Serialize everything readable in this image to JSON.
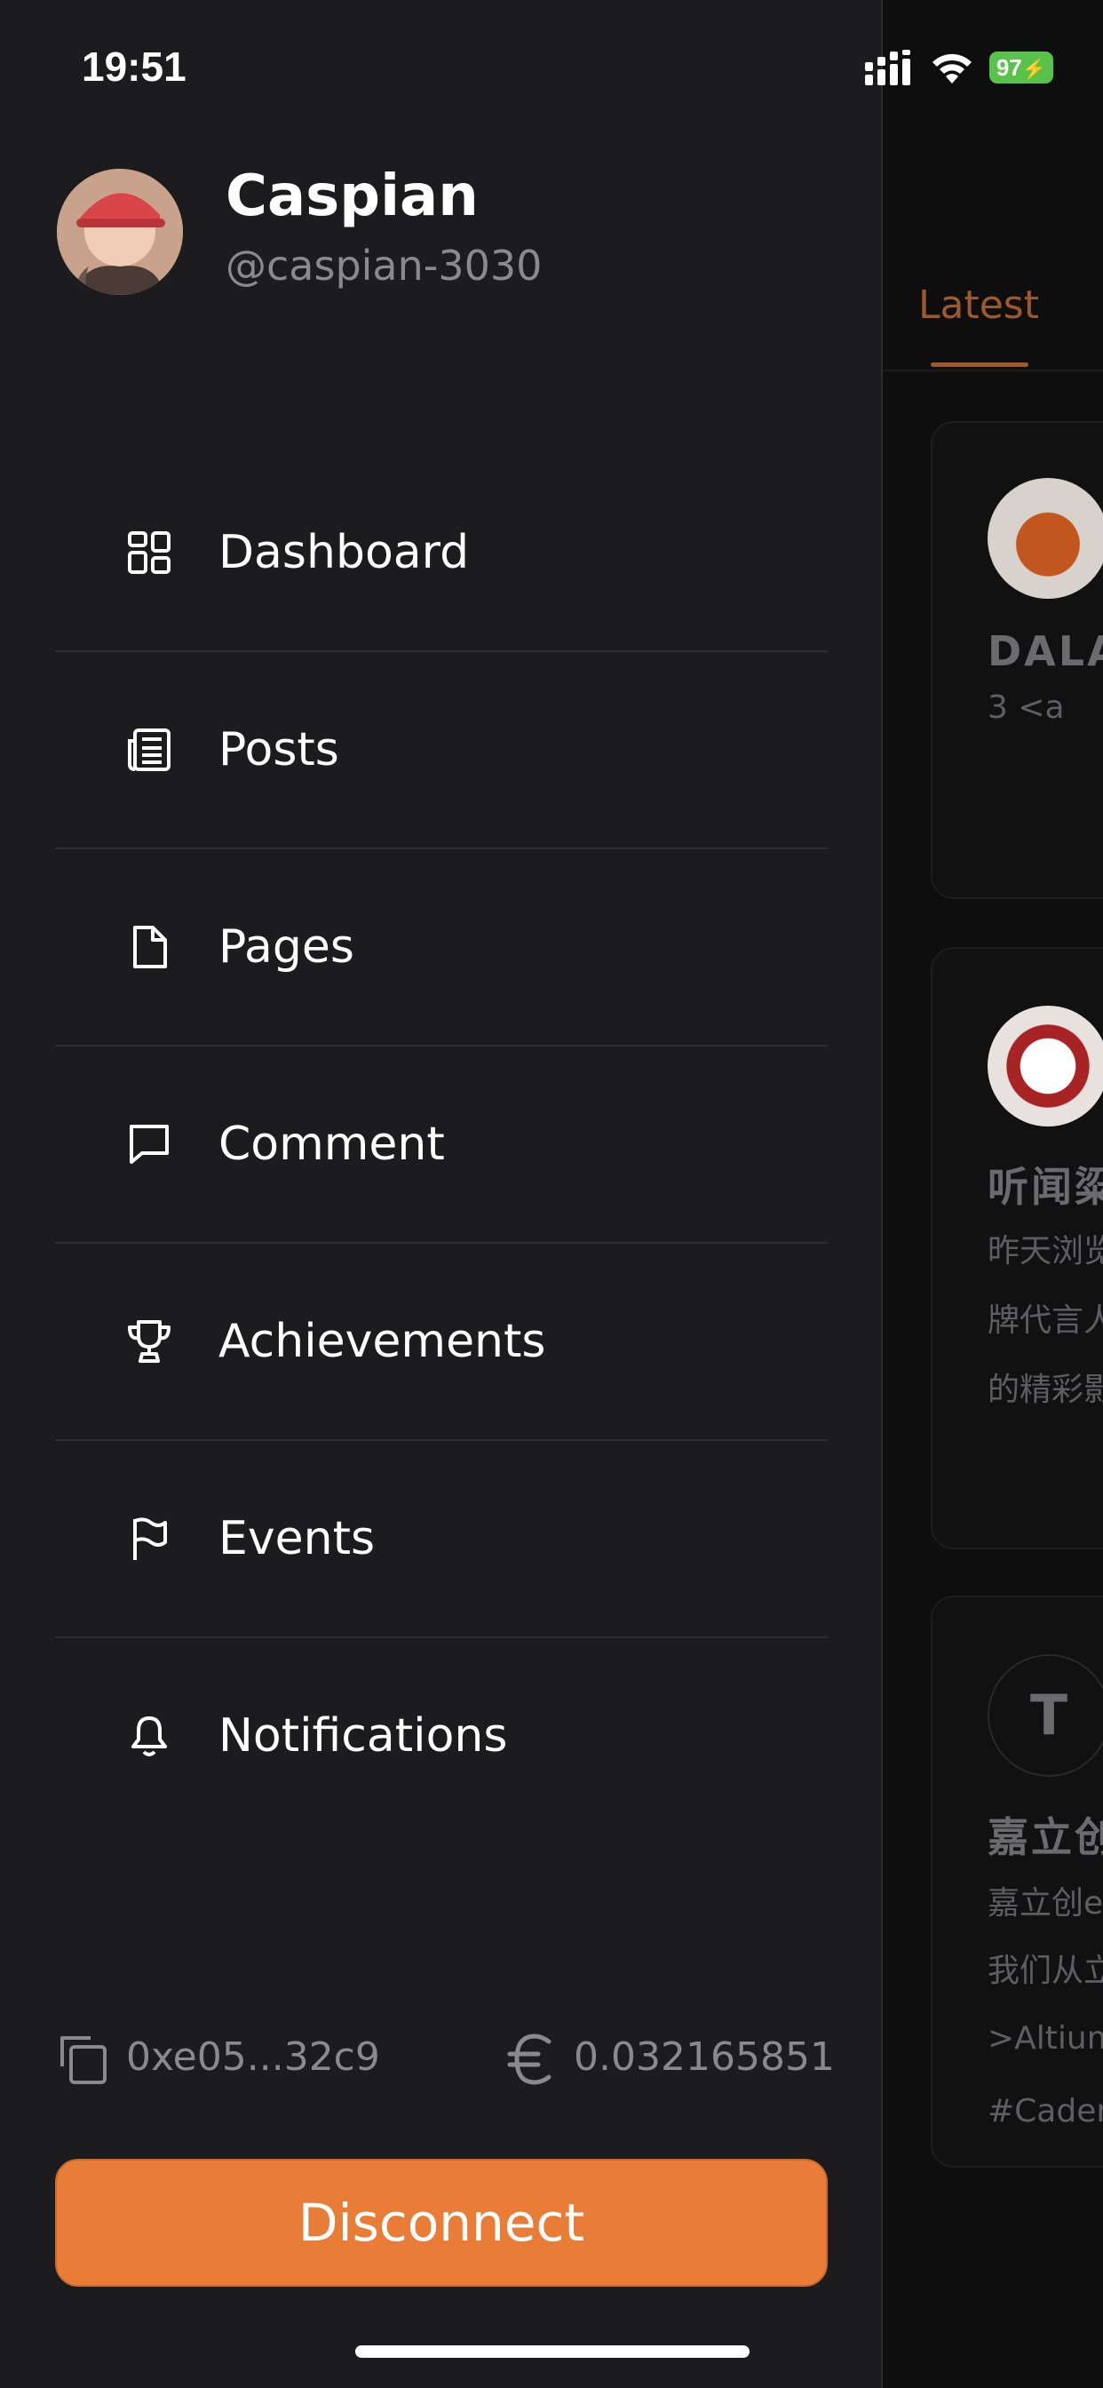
{
  "status_bar": {
    "time": "19:51",
    "battery": "97"
  },
  "profile": {
    "name": "Caspian",
    "handle": "@caspian-3030"
  },
  "menu": {
    "items": [
      {
        "label": "Dashboard",
        "icon": "dashboard-icon"
      },
      {
        "label": "Posts",
        "icon": "posts-icon"
      },
      {
        "label": "Pages",
        "icon": "page-icon"
      },
      {
        "label": "Comment",
        "icon": "comment-icon"
      },
      {
        "label": "Achievements",
        "icon": "trophy-icon"
      },
      {
        "label": "Events",
        "icon": "flag-icon"
      },
      {
        "label": "Notifications",
        "icon": "bell-icon"
      }
    ]
  },
  "wallet": {
    "address": "0xe05...32c9",
    "balance": "0.032165851"
  },
  "actions": {
    "disconnect_label": "Disconnect"
  },
  "feed": {
    "active_tab": "Latest",
    "cards": [
      {
        "title": "DALA",
        "line1": "3   <a"
      },
      {
        "title": "听闻粱",
        "line1": "昨天浏览",
        "line2": "牌代言人",
        "line3": "的精彩影"
      },
      {
        "avatar_letter": "T",
        "title": "嘉立创",
        "line1": "嘉立创e",
        "line2": "我们从立",
        "line3": ">Altium",
        "line4": "#Cader"
      }
    ]
  },
  "colors": {
    "accent": "#e97c36",
    "drawer_bg": "#1c1c1e",
    "muted_text": "#8a8a8d"
  }
}
